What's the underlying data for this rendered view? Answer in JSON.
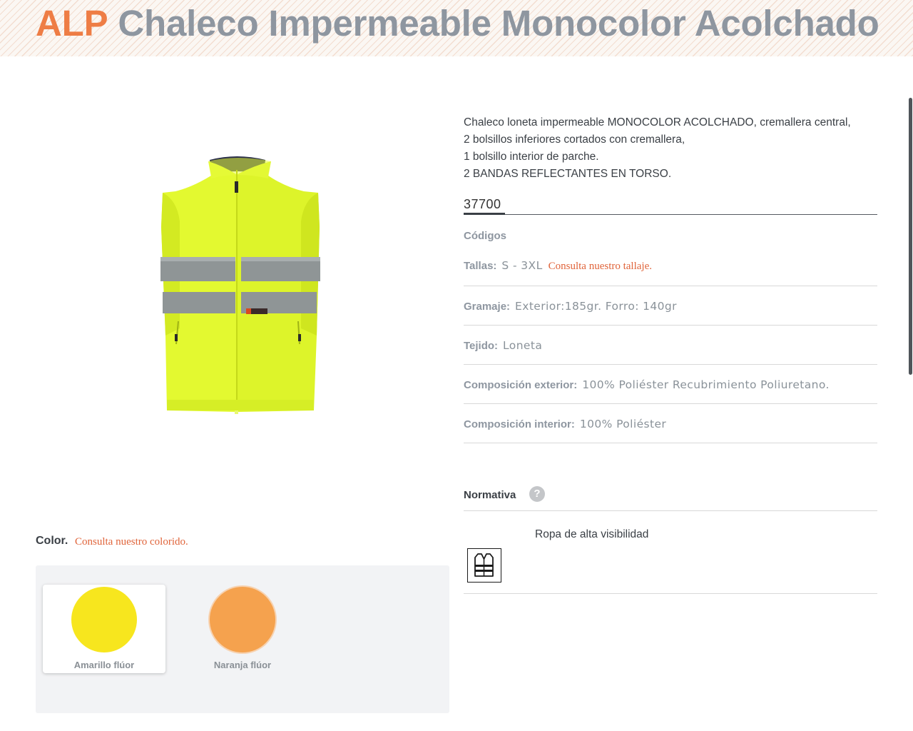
{
  "header": {
    "brand": "ALP",
    "product_name": "Chaleco Impermeable Monocolor Acolchado"
  },
  "product": {
    "image_alt": "Chaleco amarillo flúor de alta visibilidad con bandas reflectantes",
    "description_lines": [
      "Chaleco loneta impermeable MONOCOLOR ACOLCHADO, cremallera central,",
      "2 bolsillos inferiores cortados con cremallera,",
      "1 bolsillo interior de parche.",
      "2 BANDAS REFLECTANTES EN TORSO."
    ],
    "reference": "37700"
  },
  "codes": {
    "label": "Códigos"
  },
  "specs": {
    "tallas": {
      "label": "Tallas:",
      "value": "S - 3XL",
      "link": "Consulta nuestro tallaje."
    },
    "gramaje": {
      "label": "Gramaje:",
      "value": "Exterior:185gr. Forro: 140gr"
    },
    "tejido": {
      "label": "Tejido:",
      "value": "Loneta"
    },
    "comp_ext": {
      "label": "Composición exterior:",
      "value": "100% Poliéster Recubrimiento Poliuretano."
    },
    "comp_int": {
      "label": "Composición interior:",
      "value": "100% Poliéster"
    }
  },
  "normativa": {
    "label": "Normativa",
    "help_icon": "?",
    "items": [
      {
        "icon": "high-visibility-vest-icon",
        "text": "Ropa de alta visibilidad"
      }
    ]
  },
  "color": {
    "label": "Color.",
    "link": "Consulta nuestro colorido.",
    "swatches": [
      {
        "name": "Amarillo flúor",
        "hex": "#f7e61e",
        "selected": true
      },
      {
        "name": "Naranja flúor",
        "hex": "#f5a24e",
        "selected": false
      }
    ]
  },
  "theme": {
    "brand_color": "#ee7d45",
    "title_color": "#8e96a0",
    "link_color": "#e0643a"
  }
}
